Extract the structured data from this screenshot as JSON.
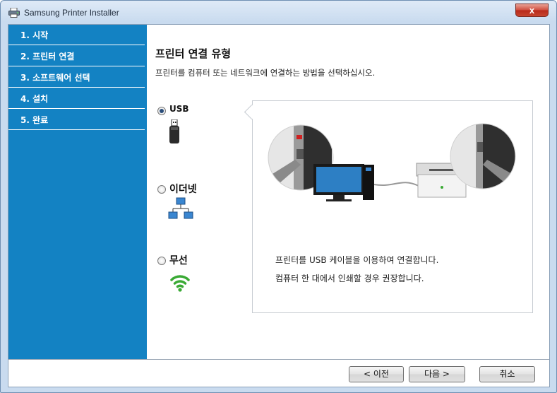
{
  "window": {
    "title": "Samsung Printer Installer",
    "close_glyph": "x"
  },
  "sidebar": {
    "items": [
      {
        "label": "1. 시작"
      },
      {
        "label": "2. 프린터 연결"
      },
      {
        "label": "3. 소프트웨어 선택"
      },
      {
        "label": "4. 설치"
      },
      {
        "label": "5. 완료"
      }
    ]
  },
  "main": {
    "heading": "프린터 연결 유형",
    "subtitle": "프린터를 컴퓨터 또는 네트워크에 연결하는 방법을 선택하십시오.",
    "options": [
      {
        "label": "USB",
        "selected": true,
        "icon": "usb-icon"
      },
      {
        "label": "이더넷",
        "selected": false,
        "icon": "network-icon"
      },
      {
        "label": "무선",
        "selected": false,
        "icon": "wifi-icon"
      }
    ],
    "description": [
      "프린터를 USB 케이블을 이용하여 연결합니다.",
      "컴퓨터 한 대에서 인쇄할 경우 권장합니다."
    ]
  },
  "footer": {
    "back_label": "< 이전",
    "next_label": "다음 >",
    "cancel_label": "취소"
  },
  "colors": {
    "sidebar": "#1382c3",
    "close_button": "#c7452f",
    "wifi": "#3aaa35"
  }
}
